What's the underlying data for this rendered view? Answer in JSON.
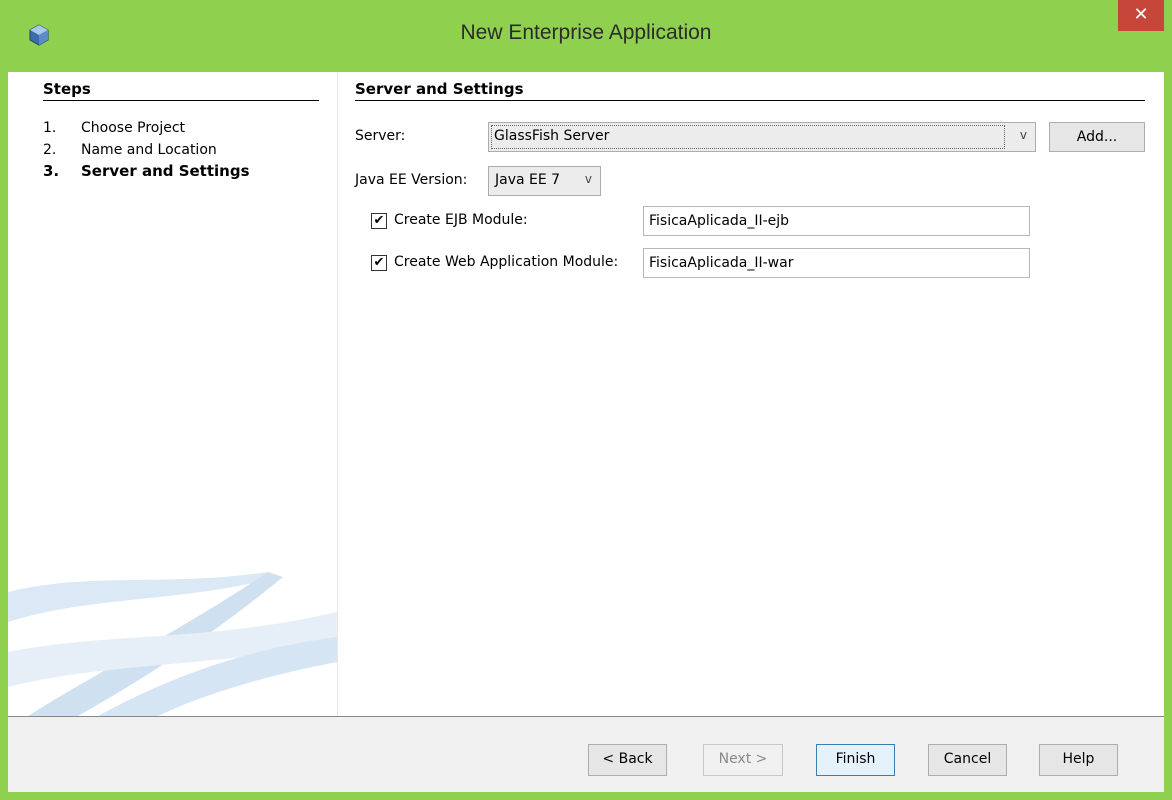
{
  "window": {
    "title": "New Enterprise Application",
    "close_label": "✕",
    "icon": "netbeans-cube-icon"
  },
  "steps": {
    "heading": "Steps",
    "items": [
      {
        "num": "1.",
        "label": "Choose Project"
      },
      {
        "num": "2.",
        "label": "Name and Location"
      },
      {
        "num": "3.",
        "label": "Server and Settings"
      }
    ]
  },
  "settings": {
    "heading": "Server and Settings",
    "server_label": "Server:",
    "server_value": "GlassFish Server",
    "add_label": "Add...",
    "javaee_label": "Java EE Version:",
    "javaee_value": "Java EE 7",
    "ejb_label": "Create EJB Module:",
    "ejb_checked": "✔",
    "ejb_value": "FisicaAplicada_II-ejb",
    "web_label": "Create Web Application Module:",
    "web_checked": "✔",
    "web_value": "FisicaAplicada_II-war",
    "chevron": "v"
  },
  "footer": {
    "back_label": "< Back",
    "next_label": "Next >",
    "finish_label": "Finish",
    "cancel_label": "Cancel",
    "help_label": "Help"
  },
  "colors": {
    "frame": "#8fd14f",
    "close": "#c7463a",
    "footer": "#f0f0f0"
  }
}
